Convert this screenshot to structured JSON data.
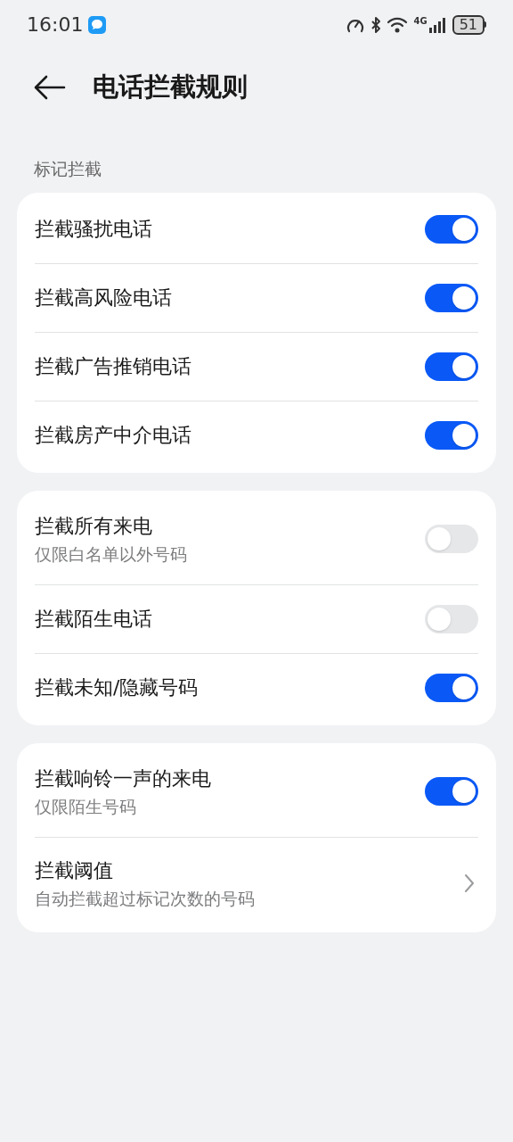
{
  "status_bar": {
    "time": "16:01",
    "network": "4G",
    "battery": "51"
  },
  "header": {
    "title": "电话拦截规则"
  },
  "section_label": "标记拦截",
  "groups": [
    {
      "items": [
        {
          "kind": "toggle",
          "title": "拦截骚扰电话",
          "on": true
        },
        {
          "kind": "toggle",
          "title": "拦截高风险电话",
          "on": true
        },
        {
          "kind": "toggle",
          "title": "拦截广告推销电话",
          "on": true
        },
        {
          "kind": "toggle",
          "title": "拦截房产中介电话",
          "on": true
        }
      ]
    },
    {
      "items": [
        {
          "kind": "toggle",
          "title": "拦截所有来电",
          "subtitle": "仅限白名单以外号码",
          "on": false
        },
        {
          "kind": "toggle",
          "title": "拦截陌生电话",
          "on": false
        },
        {
          "kind": "toggle",
          "title": "拦截未知/隐藏号码",
          "on": true
        }
      ]
    },
    {
      "items": [
        {
          "kind": "toggle",
          "title": "拦截响铃一声的来电",
          "subtitle": "仅限陌生号码",
          "on": true
        },
        {
          "kind": "link",
          "title": "拦截阈值",
          "subtitle": "自动拦截超过标记次数的号码"
        }
      ]
    }
  ]
}
